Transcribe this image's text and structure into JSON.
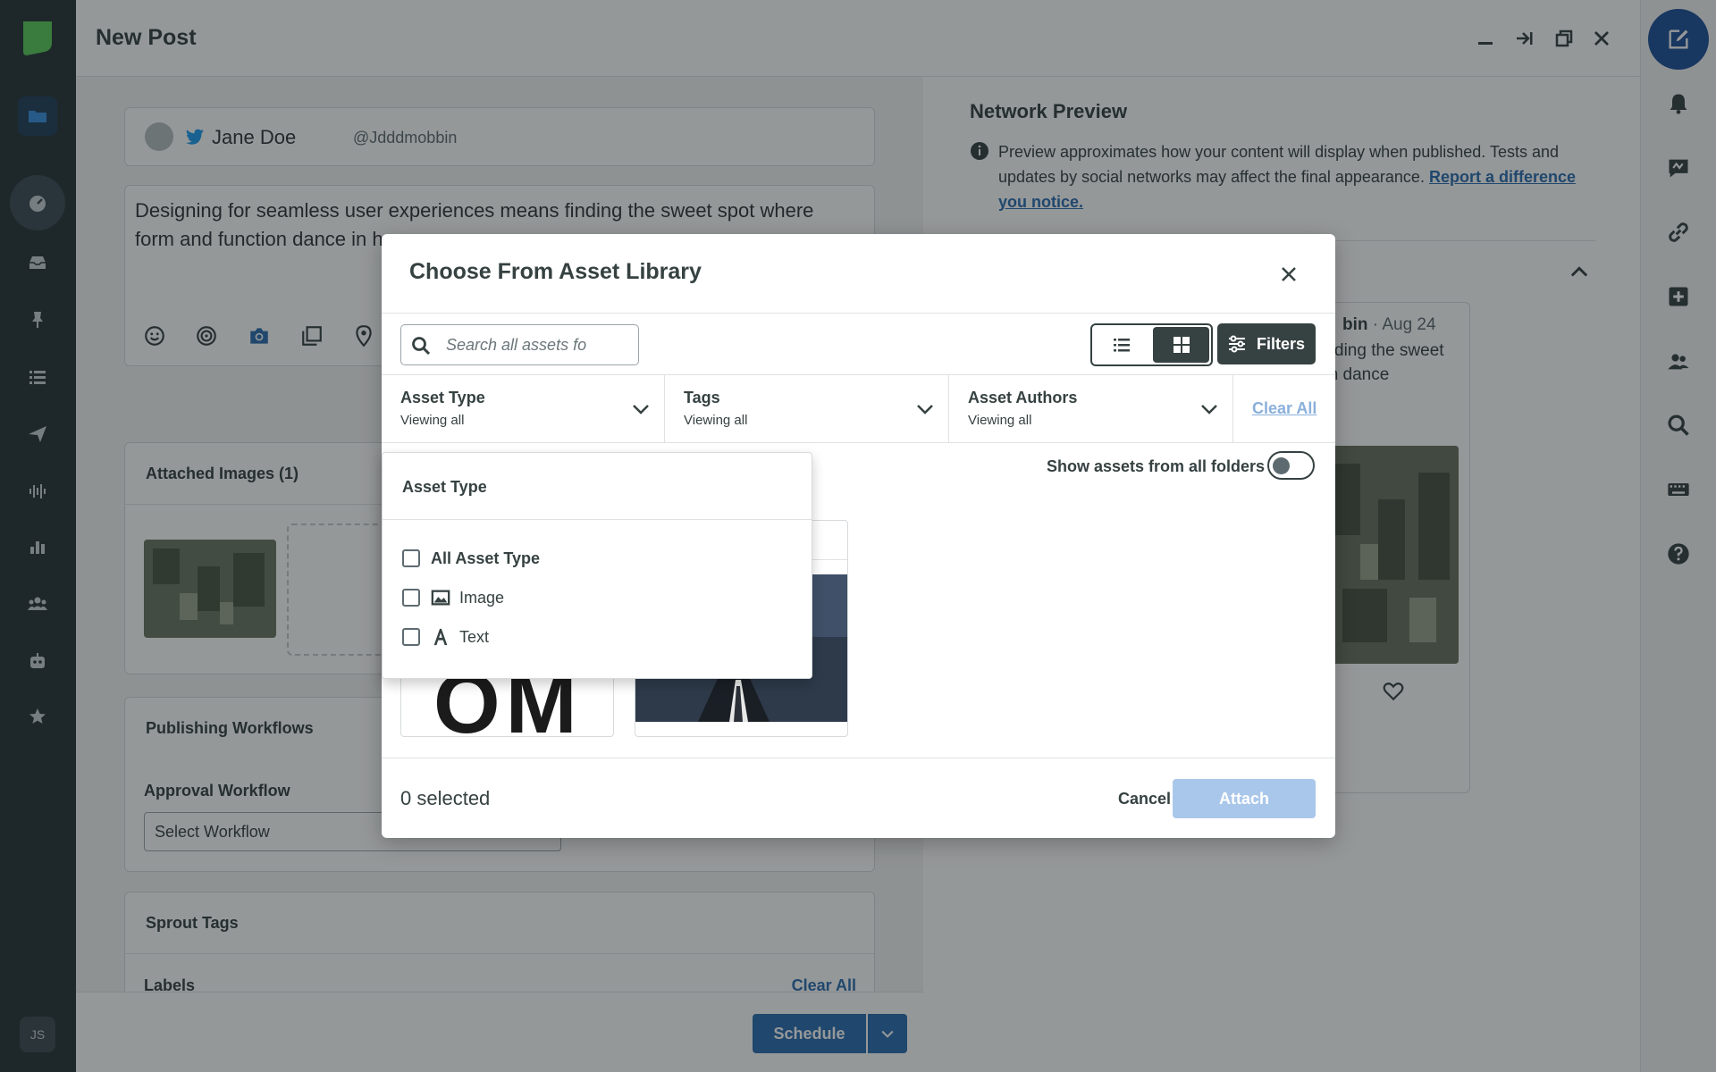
{
  "header": {
    "title": "New Post"
  },
  "profile": {
    "name": "Jane Doe",
    "handle": "@Jdddmobbin"
  },
  "composer": {
    "text": "Designing for seamless user experiences means finding the sweet spot where form and function dance in harmo"
  },
  "attached_images": {
    "title": "Attached Images (1)"
  },
  "publishing": {
    "title": "Publishing Workflows",
    "approval_label": "Approval Workflow",
    "select_placeholder": "Select Workflow"
  },
  "sprout_tags": {
    "title": "Sprout Tags",
    "labels_label": "Labels",
    "clear_all": "Clear All"
  },
  "footer": {
    "schedule": "Schedule"
  },
  "preview": {
    "title": "Network Preview",
    "note": "Preview approximates how your content will display when published. Tests and updates by social networks may affect the final appearance.",
    "link": "Report a difference you notice.",
    "post_author_partial": "bin",
    "post_date": "· Aug 24",
    "post_text": "s user ding the sweet unction dance"
  },
  "sidebar": {
    "avatar_initials": "JS"
  },
  "modal": {
    "title": "Choose From Asset Library",
    "search_placeholder": "Search all assets fo",
    "filters_label": "Filters",
    "filter_columns": [
      {
        "name": "Asset Type",
        "value": "Viewing all"
      },
      {
        "name": "Tags",
        "value": "Viewing all"
      },
      {
        "name": "Asset Authors",
        "value": "Viewing all"
      }
    ],
    "clear_all": "Clear All",
    "show_all_folders": "Show assets from all folders",
    "text_asset_glyphs": "OM",
    "selected_count": "0 selected",
    "cancel": "Cancel",
    "attach": "Attach"
  },
  "dropdown": {
    "title": "Asset Type",
    "options": [
      {
        "label": "All Asset Type",
        "icon": "none"
      },
      {
        "label": "Image",
        "icon": "image-icon"
      },
      {
        "label": "Text",
        "icon": "text-icon"
      }
    ]
  },
  "colors": {
    "primary": "#2b6cb0",
    "dark": "#364141",
    "nav": "#273338",
    "brand_green": "#59cb59",
    "attach_disabled": "#a9c7ea"
  }
}
